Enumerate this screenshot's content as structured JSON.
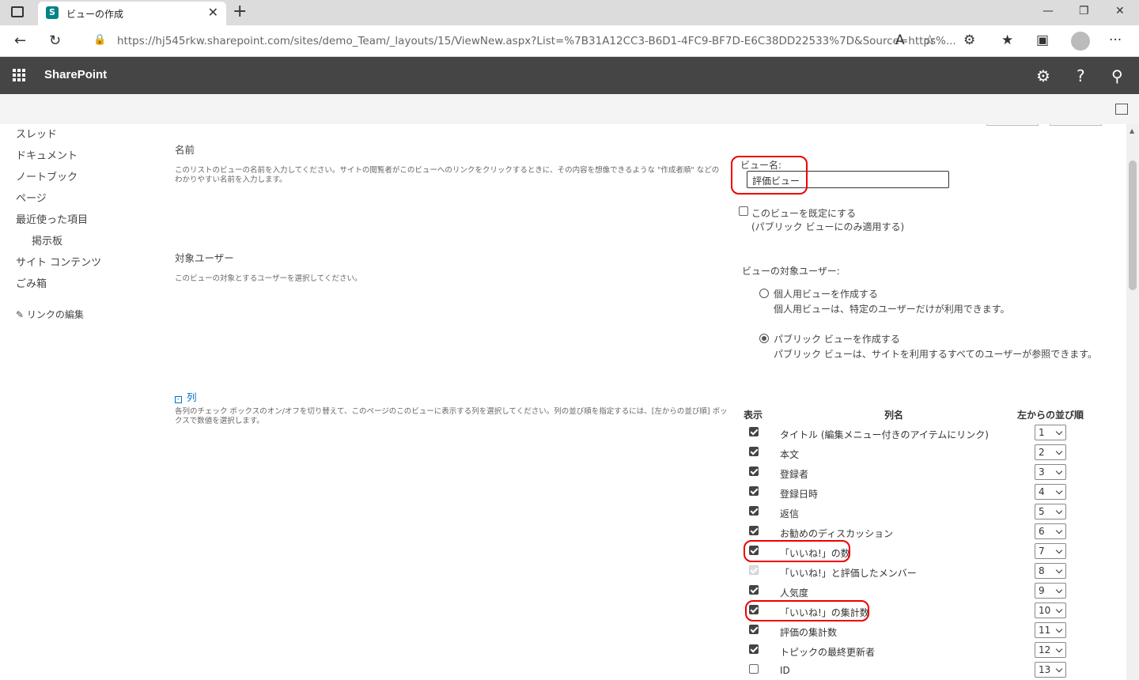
{
  "browser": {
    "tab_title": "ビューの作成",
    "tab_favicon": "S",
    "url_host": "https://hj545rkw.sharepoint.com",
    "url_path": "/sites/demo_Team/_layouts/15/ViewNew.aspx?List=%7B31A12CC3-B6D1-4FC9-BF7D-E6C38DD22533%7D&Source=https%..."
  },
  "suite": {
    "brand": "SharePoint"
  },
  "leftnav": {
    "items": [
      "スレッド",
      "ドキュメント",
      "ノートブック",
      "ページ",
      "最近使った項目"
    ],
    "sub_item": "掲示板",
    "items2": [
      "サイト コンテンツ",
      "ごみ箱"
    ],
    "edit_links": "リンクの編集"
  },
  "name_section": {
    "title": "名前",
    "desc": "このリストのビューの名前を入力してください。サイトの閲覧者がこのビューへのリンクをクリックするときに、その内容を想像できるような \"作成者順\" などのわかりやすい名前を入力します。",
    "field_label": "ビュー名:",
    "field_value": "評価ビュー",
    "default_label": "このビューを既定にする",
    "default_note": "(パブリック ビューにのみ適用する)"
  },
  "audience_section": {
    "title": "対象ユーザー",
    "desc": "このビューの対象とするユーザーを選択してください。",
    "label": "ビューの対象ユーザー:",
    "personal_label": "個人用ビューを作成する",
    "personal_desc": "個人用ビューは、特定のユーザーだけが利用できます。",
    "public_label": "パブリック ビューを作成する",
    "public_desc": "パブリック ビューは、サイトを利用するすべてのユーザーが参照できます。",
    "selected": "public"
  },
  "columns_section": {
    "title": "列",
    "desc": "各列のチェック ボックスのオン/オフを切り替えて、このページのこのビューに表示する列を選択してください。列の並び順を指定するには、[左からの並び順] ボックスで数値を選択します。",
    "headers": {
      "show": "表示",
      "name": "列名",
      "order": "左からの並び順"
    },
    "rows": [
      {
        "name": "タイトル (編集メニュー付きのアイテムにリンク)",
        "checked": true,
        "order": "1"
      },
      {
        "name": "本文",
        "checked": true,
        "order": "2"
      },
      {
        "name": "登録者",
        "checked": true,
        "order": "3"
      },
      {
        "name": "登録日時",
        "checked": true,
        "order": "4"
      },
      {
        "name": "返信",
        "checked": true,
        "order": "5"
      },
      {
        "name": "お勧めのディスカッション",
        "checked": true,
        "order": "6"
      },
      {
        "name": "「いいね!」の数",
        "checked": true,
        "order": "7"
      },
      {
        "name": "「いいね!」と評価したメンバー",
        "checked": "disabled",
        "order": "8"
      },
      {
        "name": "人気度",
        "checked": true,
        "order": "9"
      },
      {
        "name": "「いいね!」の集計数",
        "checked": true,
        "order": "10"
      },
      {
        "name": "評価の集計数",
        "checked": true,
        "order": "11"
      },
      {
        "name": "トピックの最終更新者",
        "checked": true,
        "order": "12"
      },
      {
        "name": "ID",
        "checked": false,
        "order": "13"
      }
    ]
  }
}
